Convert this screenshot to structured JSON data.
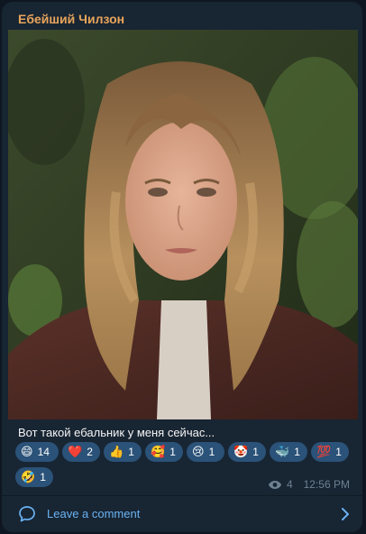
{
  "post": {
    "channel_name": "Ебейший Чилзон",
    "caption": "Вот такой ебальник у меня сейчас...",
    "views": "4",
    "time": "12:56 PM"
  },
  "reactions": [
    {
      "emoji": "😄",
      "count": "14"
    },
    {
      "emoji": "❤️",
      "count": "2"
    },
    {
      "emoji": "👍",
      "count": "1"
    },
    {
      "emoji": "🥰",
      "count": "1"
    },
    {
      "emoji": "😢",
      "count": "1"
    },
    {
      "emoji": "🤡",
      "count": "1"
    },
    {
      "emoji": "🐳",
      "count": "1"
    },
    {
      "emoji": "💯",
      "count": "1"
    },
    {
      "emoji": "🤣",
      "count": "1"
    }
  ],
  "comment": {
    "label": "Leave a comment"
  },
  "colors": {
    "background": "#0e1621",
    "card": "#182533",
    "channel_name": "#e9a55b",
    "reaction_chip": "#2b5278",
    "link": "#6ab3f3",
    "meta": "#6d8192"
  }
}
